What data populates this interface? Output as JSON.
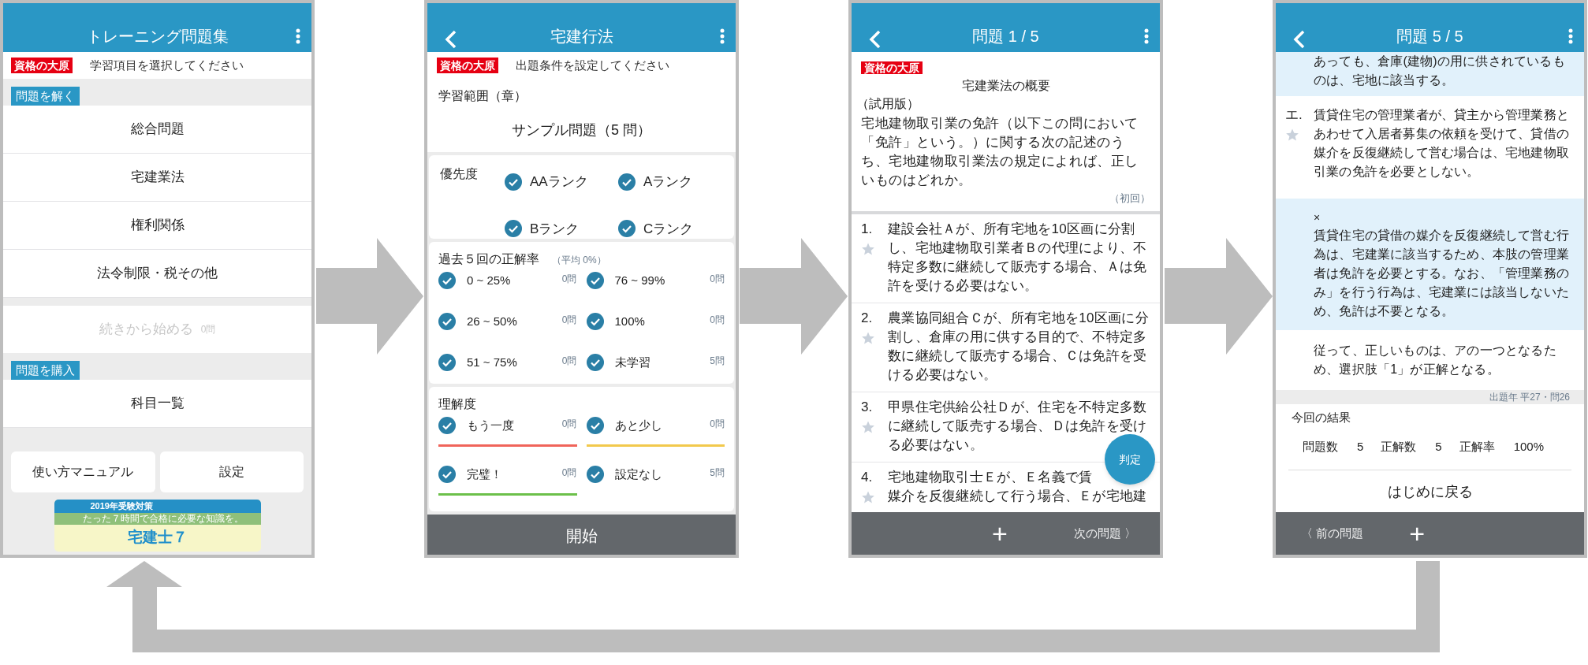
{
  "screens": [
    {
      "kind": "menu",
      "title": "トレーニング問題集",
      "back": false,
      "logo": "資格の大原",
      "instruction": "学習項目を選択してください",
      "sections": [
        {
          "label": "問題を解く",
          "items": [
            {
              "label": "総合問題"
            },
            {
              "label": "宅建業法"
            },
            {
              "label": "権利関係"
            },
            {
              "label": "法令制限・税その他"
            }
          ]
        }
      ],
      "resume": {
        "label": "続きから始める",
        "count": "0問",
        "disabled": true
      },
      "purchase": {
        "label": "問題を購入",
        "items": [
          {
            "label": "科目一覧"
          }
        ]
      },
      "buttons": [
        "使い方マニュアル",
        "設定"
      ],
      "banner": {
        "year": "2019年受験対策",
        "tagline": "たった７時間で合格に必要な知識を。",
        "title": "宅建士７"
      }
    },
    {
      "kind": "settings",
      "title": "宅建行法",
      "back": true,
      "logo": "資格の大原",
      "instruction": "出題条件を設定してください",
      "range_label": "学習範囲（章）",
      "range_value": "サンプル問題（5 問）",
      "priority": {
        "label": "優先度",
        "options": [
          {
            "label": "AAランク",
            "checked": true
          },
          {
            "label": "Aランク",
            "checked": true
          },
          {
            "label": "Bランク",
            "checked": true
          },
          {
            "label": "Cランク",
            "checked": true
          }
        ]
      },
      "accuracy": {
        "label": "過去５回の正解率",
        "note": "（平均 0%）",
        "options": [
          {
            "label": "0 ~ 25%",
            "count": "0問",
            "checked": true
          },
          {
            "label": "76 ~ 99%",
            "count": "0問",
            "checked": true
          },
          {
            "label": "26 ~ 50%",
            "count": "0問",
            "checked": true
          },
          {
            "label": "100%",
            "count": "0問",
            "checked": true
          },
          {
            "label": "51 ~ 75%",
            "count": "0問",
            "checked": true
          },
          {
            "label": "未学習",
            "count": "5問",
            "checked": true
          }
        ]
      },
      "understanding": {
        "label": "理解度",
        "options": [
          {
            "label": "もう一度",
            "count": "0問",
            "checked": true,
            "color": "#f0645a"
          },
          {
            "label": "あと少し",
            "count": "0問",
            "checked": true,
            "color": "#f2c94c"
          },
          {
            "label": "完璧！",
            "count": "0問",
            "checked": true,
            "color": "#6cc04a"
          },
          {
            "label": "設定なし",
            "count": "5問",
            "checked": true
          }
        ]
      },
      "start_button": "開始"
    },
    {
      "kind": "question",
      "title": "問題 1 / 5",
      "back": true,
      "logo": "資格の大原",
      "topic": "宅建業法の概要",
      "edition": "（試用版）",
      "question": "宅地建物取引業の免許（以下この問において「免許」という。）に関する次の記述のうち、宅地建物取引業法の規定によれば、正しいものはどれか。",
      "attempt": "（初回）",
      "choices": [
        {
          "number": "1.",
          "lines": [
            "建設会社Ａが、所有宅地を10区画に分割し、宅地建物取引業者Ｂの代理により、不特定多数に継続して販売する場合、Ａは免許を受ける必要はない。"
          ],
          "starred": false
        },
        {
          "number": "2.",
          "lines": [
            "農業協同組合Ｃが、所有宅地を10区画に分割し、倉庫の用に供する目的で、不特定多数に継続して販売する場合、Ｃは免許を受ける必要はない。"
          ],
          "starred": false
        },
        {
          "number": "3.",
          "lines": [
            "甲県住宅供給公社Ｄが、住宅を不特定多数に継続して販売する場合、Ｄは免許を受ける必要はない。"
          ],
          "starred": false
        },
        {
          "number": "4.",
          "lines": [
            "宅地建物取引士Ｅが、Ｅ名義で賃",
            "媒介を反復継続して行う場合、Ｅが宅地建"
          ],
          "starred": false
        }
      ],
      "judge_button": "判定",
      "add_button": "+",
      "next_button": "次の問題 〉"
    },
    {
      "kind": "answer",
      "title": "問題 5 / 5",
      "back": true,
      "blocks": [
        {
          "kind": "explanation",
          "text": "あっても、倉庫(建物)の用に供されているものは、宅地に該当する。"
        },
        {
          "kind": "choice",
          "number": "エ.",
          "text": "賃貸住宅の管理業者が、貸主から管理業務とあわせて入居者募集の依頼を受けて、貸借の媒介を反復継続して営む場合は、宅地建物取引業の免許を必要としない。",
          "starred": false
        },
        {
          "kind": "explanation",
          "mark": "×",
          "text": "賃貸住宅の貸借の媒介を反復継続して営む行為は、宅建業に該当するため、本肢の管理業者は免許を必要とする。なお、「管理業務のみ」を行う行為は、宅建業には該当しないため、免許は不要となる。"
        },
        {
          "kind": "conclusion",
          "text": "従って、正しいものは、アの一つとなるため、選択肢「1」が正解となる。"
        }
      ],
      "source": "出題年 平27・問26",
      "result_label": "今回の結果",
      "stats": [
        {
          "label": "問題数",
          "value": "5"
        },
        {
          "label": "正解数",
          "value": "5"
        },
        {
          "label": "正解率",
          "value": "100%"
        }
      ],
      "restart_button": "はじめに戻る",
      "prev_button": "〈 前の問題",
      "add_button": "+"
    }
  ]
}
